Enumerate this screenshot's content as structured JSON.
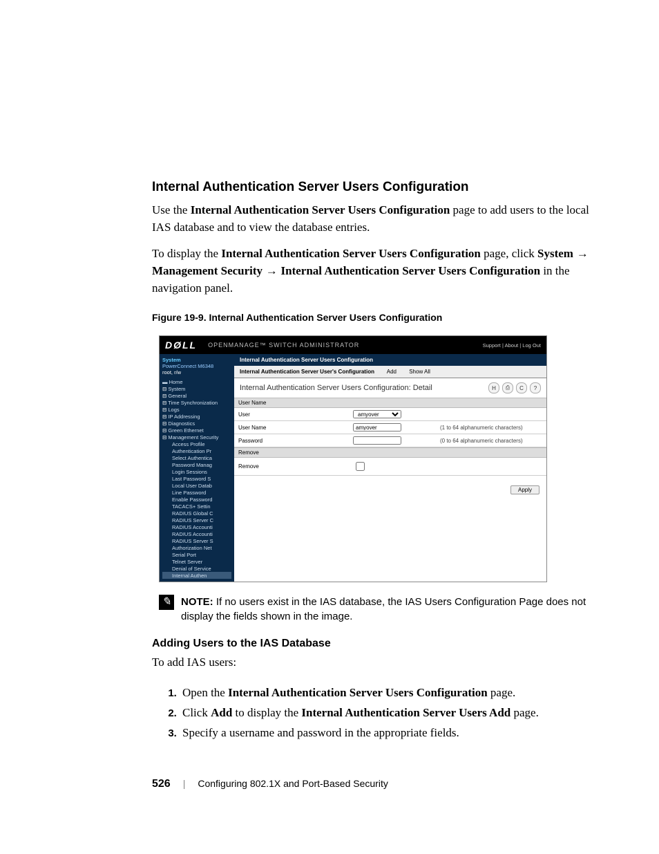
{
  "heading": "Internal Authentication Server Users Configuration",
  "para1_pre": "Use the ",
  "para1_bold": "Internal Authentication Server Users Configuration",
  "para1_post": " page to add users to the local IAS database and to view the database entries.",
  "para2_pre": "To display the ",
  "para2_bold": "Internal Authentication Server Users Configuration",
  "para2_mid": " page, click ",
  "nav1": "System",
  "nav2": "Management Security",
  "nav3": "Internal Authentication Server Users Configuration",
  "para2_post": " in the navigation panel.",
  "figure_caption": "Figure 19-9.   Internal Authentication Server Users Configuration",
  "screenshot": {
    "logo": "DØLL",
    "brand": "OPENMANAGE™ SWITCH ADMINISTRATOR",
    "toplinks": "Support | About | Log Out",
    "sidebar_head": "System",
    "sidebar_sub": "PowerConnect M6348",
    "sidebar_user": "root, r/w",
    "tree": {
      "home": "Home",
      "system": "System",
      "lvl1": [
        "General",
        "Time Synchronization",
        "Logs",
        "IP Addressing",
        "Diagnostics",
        "Green Ethernet",
        "Management Security"
      ],
      "lvl2": [
        "Access Profile",
        "Authentication Pr",
        "Select Authentica",
        "Password Manag",
        "Login Sessions",
        "Last Password S",
        "Local User Datab",
        "Line Password",
        "Enable Password",
        "TACACS+ Settin",
        "RADIUS Global C",
        "RADIUS Server C",
        "RADIUS Accounti",
        "RADIUS Accounti",
        "RADIUS Server S",
        "Authorization Net",
        "Serial Port",
        "Telnet Server",
        "Denial of Service",
        "Internal Authen"
      ]
    },
    "crumb": "Internal Authentication Server Users Configuration",
    "tab_main": "Internal Authentication Server User's Configuration",
    "tab_add": "Add",
    "tab_showall": "Show All",
    "detail_head": "Internal Authentication Server Users Configuration: Detail",
    "sec_username": "User Name",
    "row_user": "User",
    "row_user_val": "amyover",
    "row_username": "User Name",
    "row_username_val": "amyover",
    "row_username_hint": "(1 to 64 alphanumeric characters)",
    "row_password": "Password",
    "row_password_hint": "(0 to 64 alphanumeric characters)",
    "sec_remove": "Remove",
    "row_remove": "Remove",
    "apply": "Apply"
  },
  "note_label": "NOTE:",
  "note_text": " If no users exist in the IAS database, the IAS Users Configuration Page does not display the fields shown in the image.",
  "subheading": "Adding Users to the IAS Database",
  "lead_in": "To add IAS users:",
  "steps": {
    "s1_pre": "Open the ",
    "s1_bold": "Internal Authentication Server Users Configuration",
    "s1_post": " page.",
    "s2_pre": "Click ",
    "s2_b1": "Add",
    "s2_mid": " to display the ",
    "s2_b2": "Internal Authentication Server Users Add",
    "s2_post": " page.",
    "s3": "Specify a username and password in the appropriate fields."
  },
  "footer_page": "526",
  "footer_title": "Configuring 802.1X and Port-Based Security"
}
